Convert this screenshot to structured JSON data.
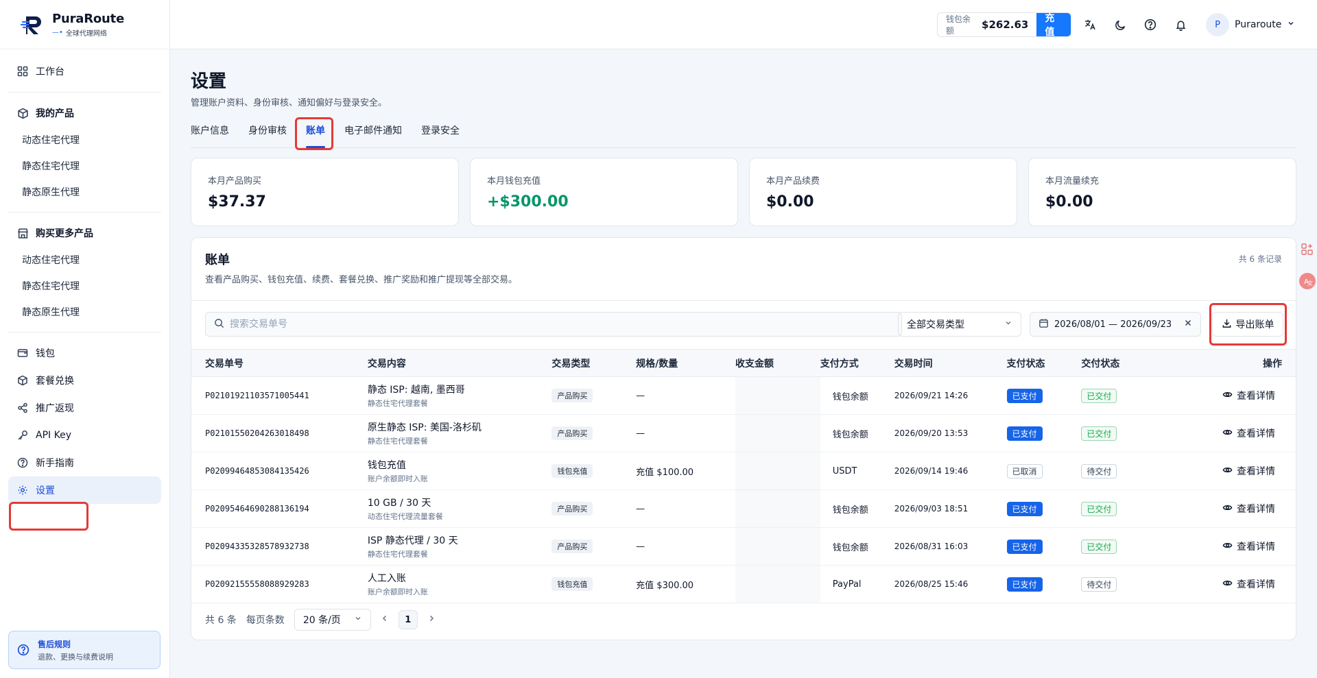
{
  "brand": {
    "name": "PuraRoute",
    "tagline": "全球代理网络"
  },
  "sidebar": {
    "workbench": "工作台",
    "my_products": "我的产品",
    "my_products_items": [
      "动态住宅代理",
      "静态住宅代理",
      "静态原生代理"
    ],
    "buy_more": "购买更多产品",
    "buy_more_items": [
      "动态住宅代理",
      "静态住宅代理",
      "静态原生代理"
    ],
    "wallet": "钱包",
    "redeem": "套餐兑换",
    "referral": "推广返现",
    "api_key": "API Key",
    "guide": "新手指南",
    "settings": "设置",
    "after_sale_title": "售后规则",
    "after_sale_sub": "退款、更换与续费说明"
  },
  "topbar": {
    "wallet_label": "钱包余额",
    "wallet_amount": "$262.63",
    "recharge": "充值",
    "user_initial": "P",
    "user_name": "Puraroute"
  },
  "page": {
    "title": "设置",
    "subtitle": "管理账户资料、身份审核、通知偏好与登录安全。",
    "tabs": [
      "账户信息",
      "身份审核",
      "账单",
      "电子邮件通知",
      "登录安全"
    ]
  },
  "stats": [
    {
      "label": "本月产品购买",
      "value": "$37.37"
    },
    {
      "label": "本月钱包充值",
      "value": "+$300.00"
    },
    {
      "label": "本月产品续费",
      "value": "$0.00"
    },
    {
      "label": "本月流量续充",
      "value": "$0.00"
    }
  ],
  "bill": {
    "title": "账单",
    "subtitle": "查看产品购买、钱包充值、续费、套餐兑换、推广奖励和推广提现等全部交易。",
    "count": "共 6 条记录",
    "search_placeholder": "搜索交易单号",
    "type_filter": "全部交易类型",
    "date_range": "2026/08/01 — 2026/09/23",
    "export": "导出账单",
    "columns": [
      "交易单号",
      "交易内容",
      "交易类型",
      "规格/数量",
      "收支金额",
      "支付方式",
      "交易时间",
      "支付状态",
      "交付状态",
      "操作"
    ],
    "rows": [
      {
        "id": "P02101921103571005441",
        "title": "静态 ISP: 越南, 墨西哥",
        "sub": "静态住宅代理套餐",
        "type": "产品购买",
        "spec": "—",
        "method": "钱包余额",
        "time": "2026/09/21 14:26",
        "pay": "已支付",
        "pay_style": "blue",
        "deliver": "已交付",
        "deliver_style": "green",
        "action": "查看详情"
      },
      {
        "id": "P02101550204263018498",
        "title": "原生静态 ISP: 美国-洛杉矶",
        "sub": "静态住宅代理套餐",
        "type": "产品购买",
        "spec": "—",
        "method": "钱包余额",
        "time": "2026/09/20 13:53",
        "pay": "已支付",
        "pay_style": "blue",
        "deliver": "已交付",
        "deliver_style": "green",
        "action": "查看详情"
      },
      {
        "id": "P02099464853084135426",
        "title": "钱包充值",
        "sub": "账户余额即时入账",
        "type": "钱包充值",
        "spec": "充值 $100.00",
        "method": "USDT",
        "time": "2026/09/14 19:46",
        "pay": "已取消",
        "pay_style": "outline",
        "deliver": "待交付",
        "deliver_style": "outline",
        "action": "查看详情"
      },
      {
        "id": "P02095464690288136194",
        "title": "10 GB / 30 天",
        "sub": "动态住宅代理流量套餐",
        "type": "产品购买",
        "spec": "—",
        "method": "钱包余额",
        "time": "2026/09/03 18:51",
        "pay": "已支付",
        "pay_style": "blue",
        "deliver": "已交付",
        "deliver_style": "green",
        "action": "查看详情"
      },
      {
        "id": "P02094335328578932738",
        "title": "ISP 静态代理 / 30 天",
        "sub": "静态住宅代理套餐",
        "type": "产品购买",
        "spec": "—",
        "method": "钱包余额",
        "time": "2026/08/31 16:03",
        "pay": "已支付",
        "pay_style": "blue",
        "deliver": "已交付",
        "deliver_style": "green",
        "action": "查看详情"
      },
      {
        "id": "P02092155558088929283",
        "title": "人工入账",
        "sub": "账户余额即时入账",
        "type": "钱包充值",
        "spec": "充值 $300.00",
        "method": "PayPal",
        "time": "2026/08/25 15:46",
        "pay": "已支付",
        "pay_style": "blue",
        "deliver": "待交付",
        "deliver_style": "outline",
        "action": "查看详情"
      }
    ]
  },
  "pager": {
    "total": "共 6 条",
    "per_page_label": "每页条数",
    "per_page": "20 条/页",
    "page": "1"
  },
  "colors": {
    "accent": "#1677ff",
    "highlight": "#e53935",
    "success": "#059669"
  }
}
